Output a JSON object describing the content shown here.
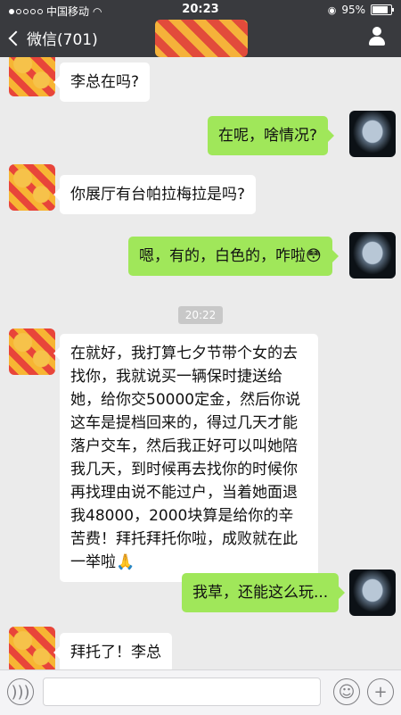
{
  "status_bar": {
    "carrier": "中国移动",
    "time": "20:23",
    "battery": "95%",
    "battery_level": 0.95
  },
  "nav": {
    "back_label": "微信(701)"
  },
  "chat": {
    "messages": [
      {
        "from": "contact",
        "text": "李总在吗?"
      },
      {
        "from": "me",
        "text": "在呢，啥情况?"
      },
      {
        "from": "contact",
        "text": "你展厅有台帕拉梅拉是吗?"
      },
      {
        "from": "me",
        "text": "嗯，有的，白色的，咋啦😳"
      },
      {
        "from": "contact",
        "text": "在就好，我打算七夕节带个女的去找你，我就说买一辆保时捷送给她，给你交50000定金，然后你说这车是提档回来的，得过几天才能落户交车，然后我正好可以叫她陪我几天，到时候再去找你的时候你再找理由说不能过户，当着她面退我48000，2000块算是给你的辛苦费！拜托拜托你啦，成败就在此一举啦🙏"
      },
      {
        "from": "me",
        "text": "我草，还能这么玩..."
      },
      {
        "from": "contact",
        "text": "拜托了！李总"
      }
    ],
    "timestamp": "20:22"
  },
  "input_bar": {
    "voice_icon": "voice-icon",
    "emoji_icon": "emoji-icon",
    "plus_icon": "plus-icon"
  }
}
